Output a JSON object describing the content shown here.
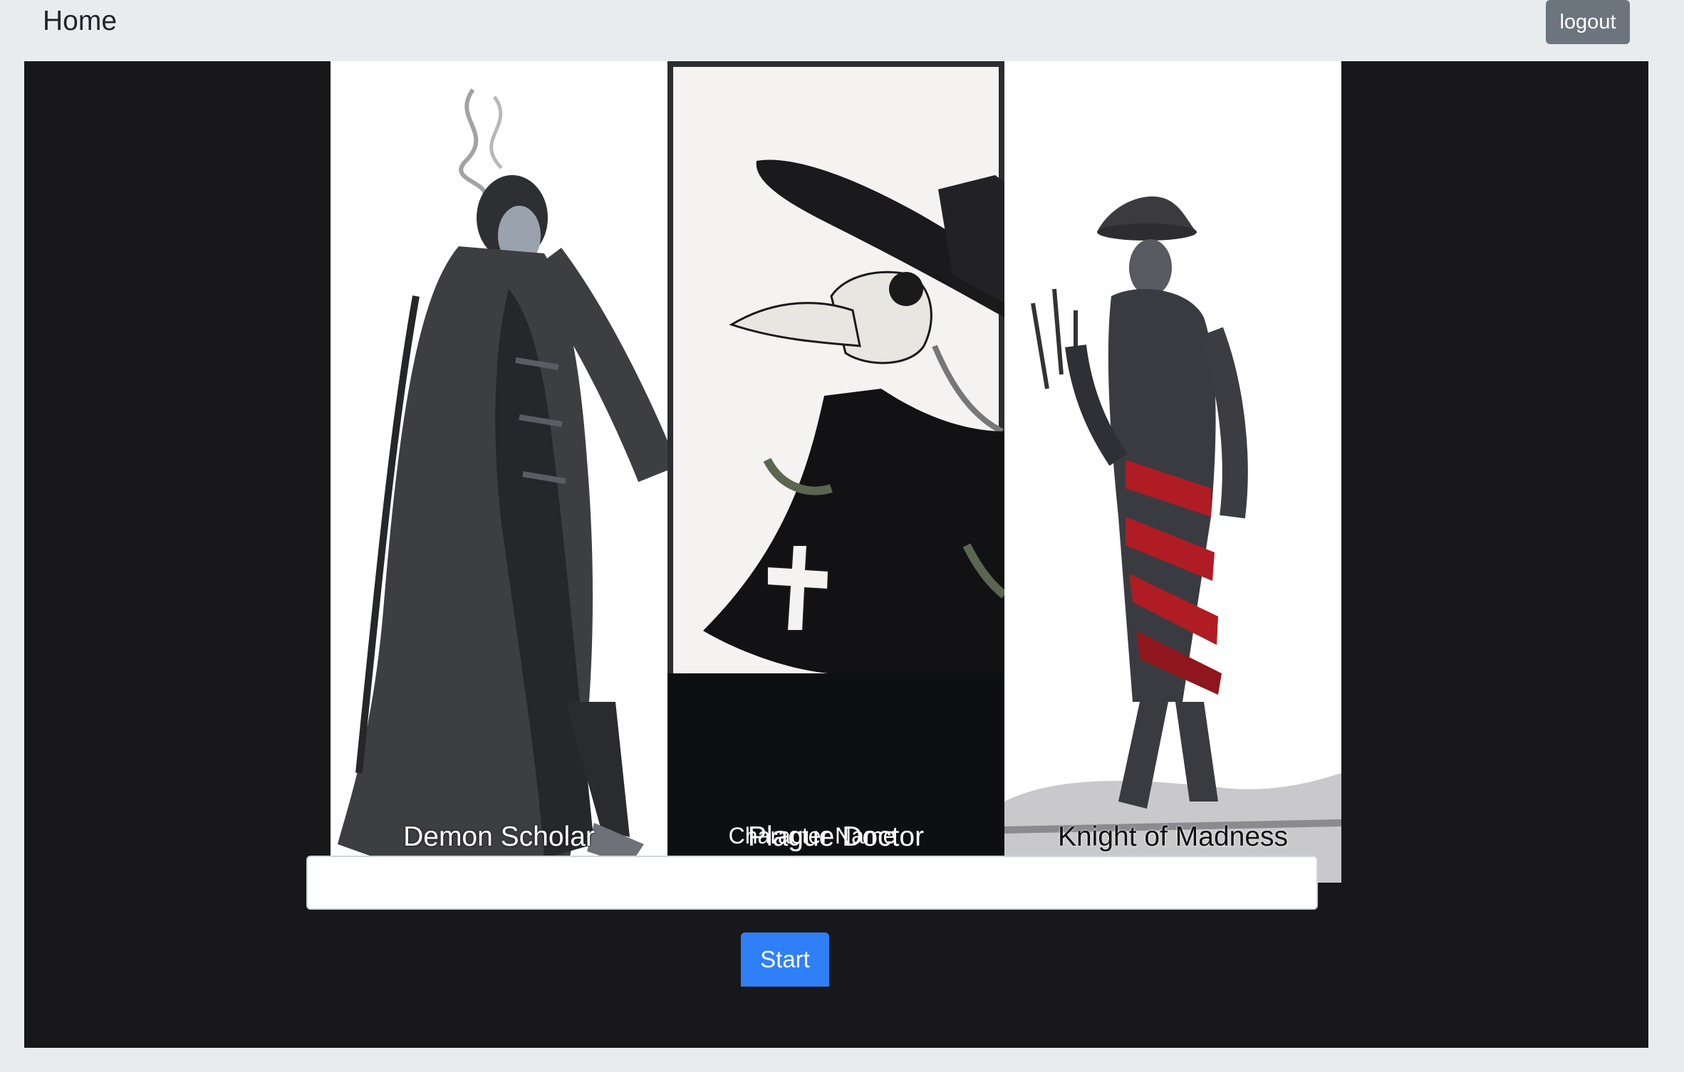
{
  "nav": {
    "brand": "Home",
    "logout_label": "logout"
  },
  "characters": [
    {
      "name": "Demon Scholar",
      "selected": false
    },
    {
      "name": "Plague Doctor",
      "selected": true
    },
    {
      "name": "Knight of Madness",
      "selected": false
    }
  ],
  "form": {
    "name_label": "Character Name",
    "name_value": "",
    "name_placeholder": "",
    "start_label": "Start"
  },
  "colors": {
    "page_bg": "#e9ecef",
    "panel_bg": "#18181a",
    "logout_bg": "#6c757d",
    "start_bg": "#2f80f7"
  }
}
